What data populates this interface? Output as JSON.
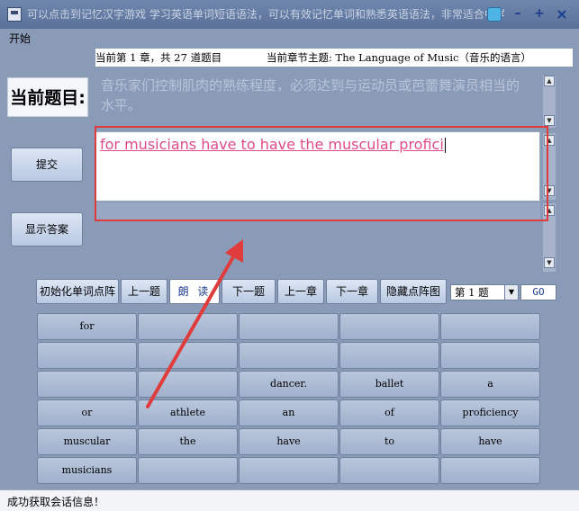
{
  "window": {
    "title": "可以点击到记忆汉字游戏 学习英语单词短语语法，可以有效记忆单词和熟悉英语语法，非常适合中学生、大学生记英语单词是使用",
    "icon": "app-window-icon",
    "controls": [
      "settings-icon",
      "minimize-icon",
      "maximize-icon",
      "close-icon"
    ]
  },
  "menu": {
    "start": "开始"
  },
  "chapter": {
    "info": "当前第 1 章，共 27 道题目",
    "topic": "当前章节主题: The Language of Music（音乐的语言）"
  },
  "left": {
    "current_label": "当前题目:",
    "submit": "提交",
    "show_answer": "显示答案"
  },
  "question": {
    "text": "音乐家们控制肌肉的熟练程度，必须达到与运动员或芭蕾舞演员相当的水平。"
  },
  "answer": {
    "text": "for musicians have to have the muscular profici"
  },
  "toolbar": {
    "init": "初始化单词点阵",
    "prev": "上一题",
    "read": "朗 读",
    "next": "下一题",
    "prev_chapter": "上一章",
    "next_chapter": "下一章",
    "hide": "隐藏点阵图",
    "select_value": "第 1 题",
    "go": "GO"
  },
  "word_grid": [
    [
      "for",
      "",
      "",
      "",
      ""
    ],
    [
      "",
      "",
      "",
      "",
      ""
    ],
    [
      "",
      "",
      "dancer.",
      "ballet",
      "a"
    ],
    [
      "or",
      "athlete",
      "an",
      "of",
      "proficiency"
    ],
    [
      "muscular",
      "the",
      "have",
      "to",
      "have"
    ],
    [
      "musicians",
      "",
      "",
      "",
      ""
    ]
  ],
  "status": {
    "text": "成功获取会话信息！"
  },
  "annotation": {
    "color": "#e03c3c"
  }
}
